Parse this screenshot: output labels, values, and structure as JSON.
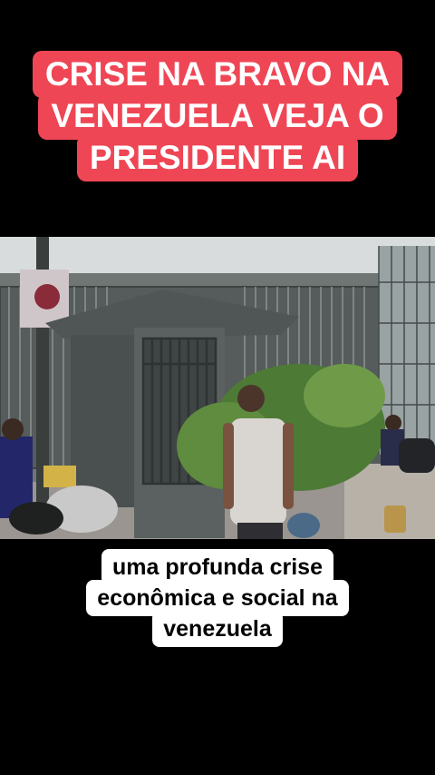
{
  "headline": {
    "lines": [
      "CRISE NA BRAVO NA",
      "VENEZUELA VEJA O",
      "PRESIDENTE AI"
    ],
    "background_color": "#ef4655",
    "text_color": "#ffffff"
  },
  "subtitle": {
    "lines": [
      "uma profunda crise",
      "econômica e social na",
      "venezuela"
    ],
    "background_color": "#ffffff",
    "text_color": "#000000"
  }
}
